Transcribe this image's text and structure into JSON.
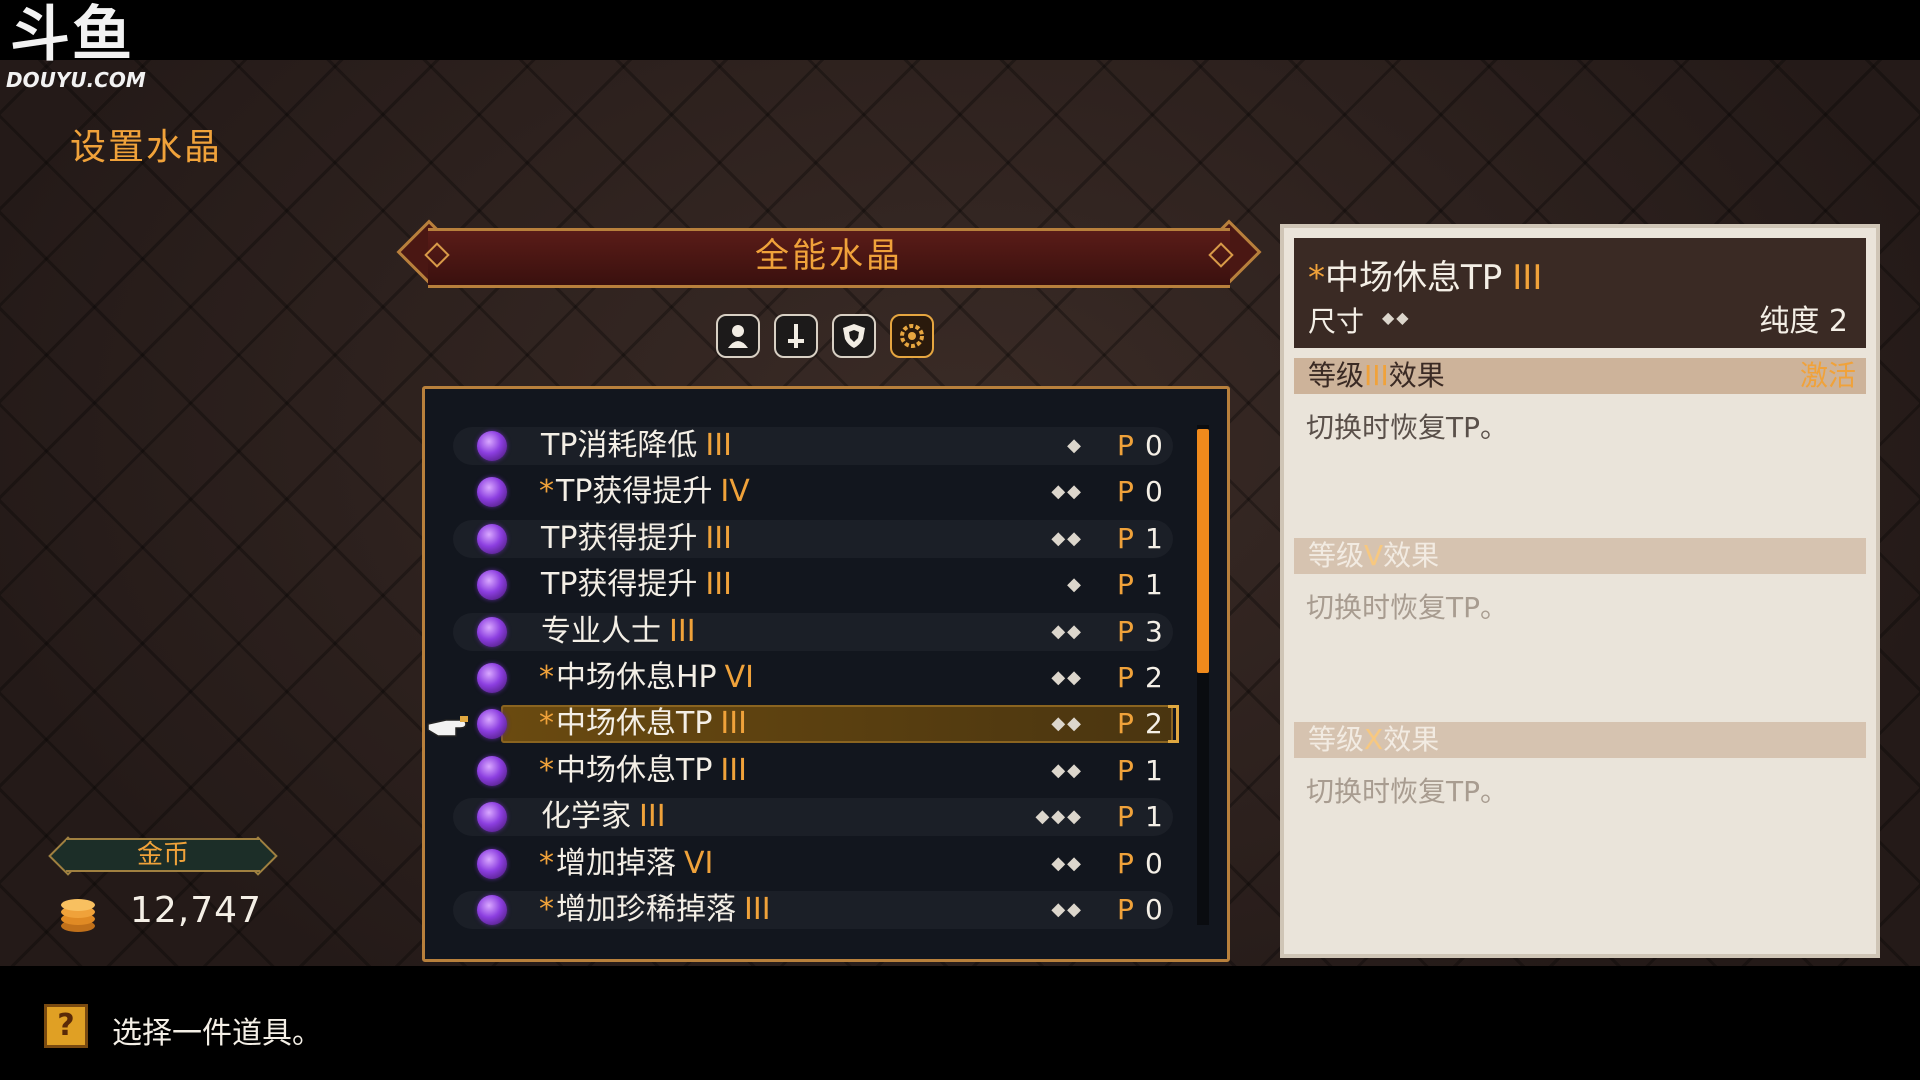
{
  "watermark": {
    "logo_text": "斗鱼",
    "url": "DOUYU.COM"
  },
  "screen_title": "设置水晶",
  "crystal_banner": {
    "title": "全能水晶"
  },
  "filter_icons": [
    "character-icon",
    "sword-icon",
    "shield-icon",
    "gear-icon"
  ],
  "crystal_list": {
    "p_prefix": "P",
    "items": [
      {
        "star": "",
        "name": "TP消耗降低",
        "level": "III",
        "size": "◆",
        "p": "0"
      },
      {
        "star": "*",
        "name": "TP获得提升",
        "level": "IV",
        "size": "◆◆",
        "p": "0"
      },
      {
        "star": "",
        "name": "TP获得提升",
        "level": "III",
        "size": "◆◆",
        "p": "1"
      },
      {
        "star": "",
        "name": "TP获得提升",
        "level": "III",
        "size": "◆",
        "p": "1"
      },
      {
        "star": "",
        "name": "专业人士",
        "level": "III",
        "size": "◆◆",
        "p": "3"
      },
      {
        "star": "*",
        "name": "中场休息HP",
        "level": "VI",
        "size": "◆◆",
        "p": "2"
      },
      {
        "star": "*",
        "name": "中场休息TP",
        "level": "III",
        "size": "◆◆",
        "p": "2"
      },
      {
        "star": "*",
        "name": "中场休息TP",
        "level": "III",
        "size": "◆◆",
        "p": "1"
      },
      {
        "star": "",
        "name": "化学家",
        "level": "III",
        "size": "◆◆◆",
        "p": "1"
      },
      {
        "star": "*",
        "name": "增加掉落",
        "level": "VI",
        "size": "◆◆",
        "p": "0"
      },
      {
        "star": "*",
        "name": "增加珍稀掉落",
        "level": "III",
        "size": "◆◆",
        "p": "0"
      }
    ]
  },
  "gold": {
    "label": "金币",
    "value": "12,747"
  },
  "detail": {
    "star": "*",
    "name": "中场休息TP",
    "level": "III",
    "size_label": "尺寸",
    "size_dots": "◆◆",
    "purity": "纯度 2",
    "effects": [
      {
        "prefix": "等级",
        "level": "III",
        "suffix": "效果",
        "status": "激活",
        "text": "切换时恢复TP。"
      },
      {
        "prefix": "等级",
        "level": "V",
        "suffix": "效果",
        "status": "",
        "text": "切换时恢复TP。"
      },
      {
        "prefix": "等级",
        "level": "X",
        "suffix": "效果",
        "status": "",
        "text": "切换时恢复TP。"
      }
    ]
  },
  "hint": {
    "icon_text": "?",
    "text": "选择一件道具。"
  },
  "colors": {
    "accent": "#f0a23a",
    "scroll": "#f08a1c",
    "panel_border": "#b8803c",
    "gem": "#8c3ee0"
  }
}
